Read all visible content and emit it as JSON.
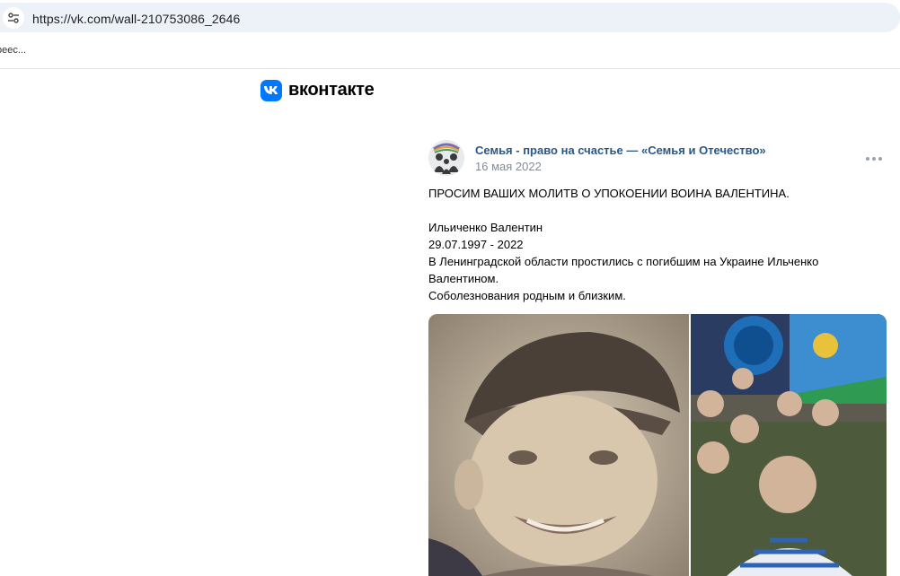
{
  "browser": {
    "url": "https://vk.com/wall-210753086_2646",
    "bookmark": "реес..."
  },
  "brand": {
    "wordmark": "вконтакте",
    "color": "#0077ff"
  },
  "post": {
    "group_name": "Семья - право на счастье — «Семья и Отечество»",
    "date": "16 мая 2022",
    "text": {
      "headline": "ПРОСИМ ВАШИХ МОЛИТВ О УПОКОЕНИИ ВОИНА ВАЛЕНТИНА.",
      "name": "Ильиченко Валентин",
      "dates": "29.07.1997 - 2022",
      "line1": "В Ленинградской области простились с погибшим на Украине Ильченко",
      "line2": "Валентином.",
      "line3": "Соболезнования родным и близким."
    },
    "colors": {
      "link": "#2a5885",
      "meta": "#818c99"
    }
  }
}
